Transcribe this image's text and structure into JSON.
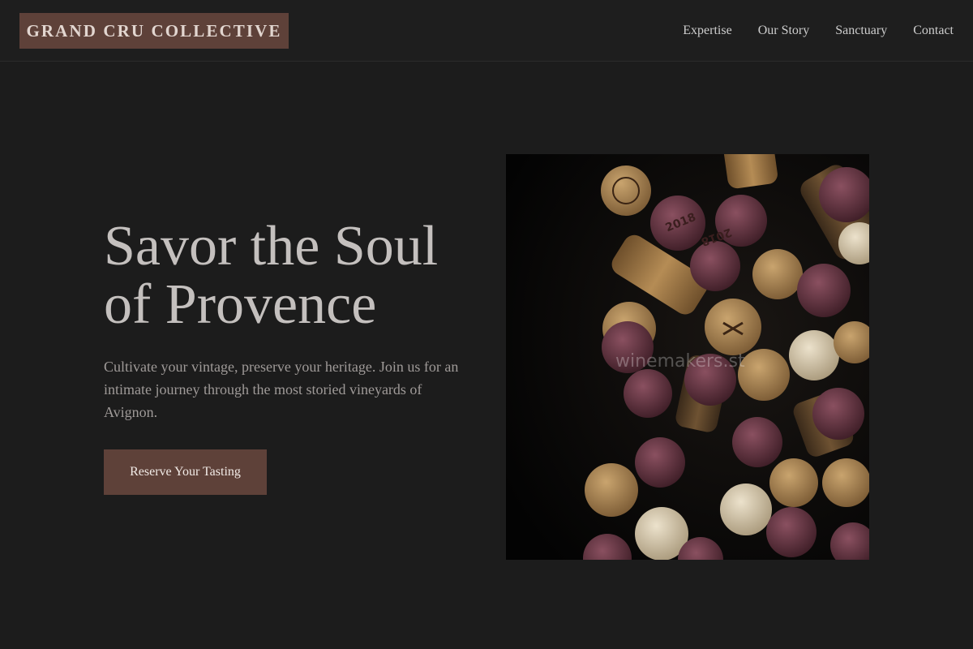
{
  "header": {
    "logo": "GRAND CRU COLLECTIVE",
    "nav": [
      "Expertise",
      "Our Story",
      "Sanctuary",
      "Contact"
    ]
  },
  "hero": {
    "title_line1": "Savor the Soul",
    "title_line2": "of Provence",
    "subtitle": "Cultivate your vintage, preserve your heritage. Join us for an intimate journey through the most storied vineyards of Avignon.",
    "cta": "Reserve Your Tasting"
  },
  "image": {
    "watermark": "winemakers.st",
    "cork_marks": [
      "2018",
      "2018"
    ]
  },
  "colors": {
    "background": "#1c1c1c",
    "accent": "#5e4139",
    "title_text": "#c4c0be",
    "body_text": "#9f9a98"
  }
}
